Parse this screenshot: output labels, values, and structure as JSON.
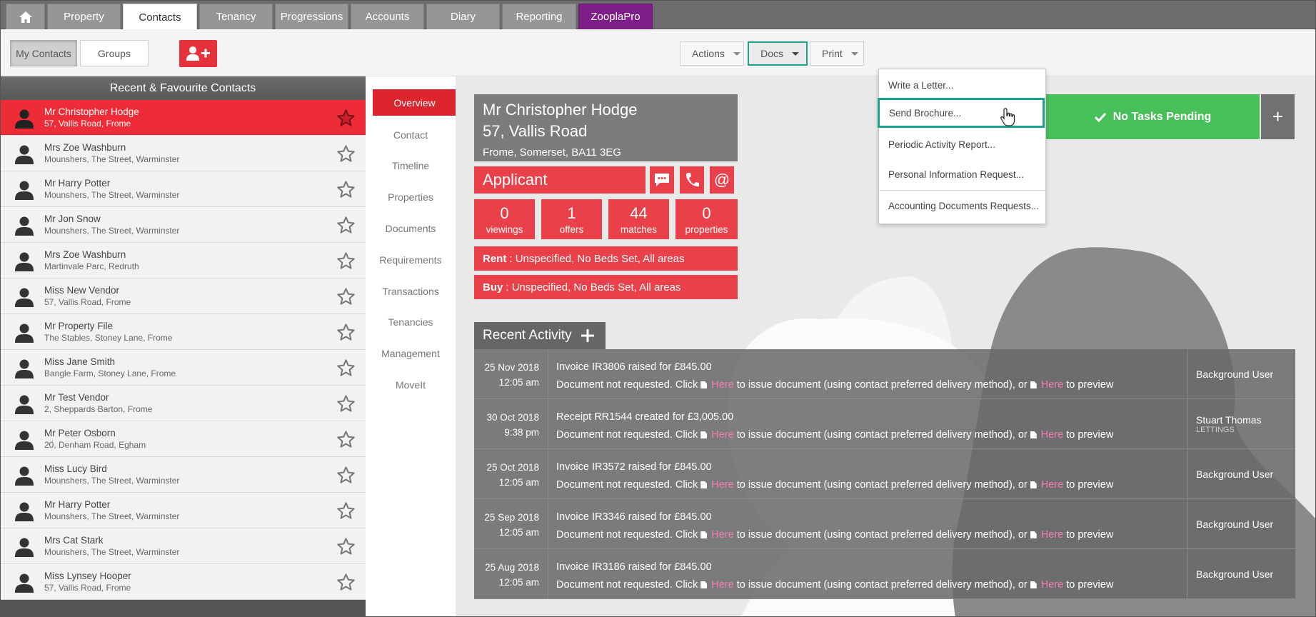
{
  "topnav": {
    "tabs": [
      {
        "label": "Property"
      },
      {
        "label": "Contacts"
      },
      {
        "label": "Tenancy"
      },
      {
        "label": "Progressions"
      },
      {
        "label": "Accounts"
      },
      {
        "label": "Diary"
      },
      {
        "label": "Reporting"
      },
      {
        "label": "ZooplaPro"
      }
    ],
    "active_tab": "Contacts",
    "zoopla_color": "#7d1f87"
  },
  "subbar": {
    "my_contacts": "My Contacts",
    "groups": "Groups",
    "actions": "Actions",
    "docs": "Docs",
    "print": "Print"
  },
  "left": {
    "header": "Recent & Favourite Contacts",
    "contacts": [
      {
        "name": "Mr Christopher Hodge",
        "address": "57, Vallis Road, Frome",
        "active": true
      },
      {
        "name": "Mrs Zoe Washburn",
        "address": "Mounshers, The Street, Warminster"
      },
      {
        "name": "Mr Harry Potter",
        "address": "Mounshers, The Street, Warminster"
      },
      {
        "name": "Mr Jon Snow",
        "address": "Mounshers, The Street, Warminster"
      },
      {
        "name": "Mrs Zoe Washburn",
        "address": "Martinvale Parc, Redruth"
      },
      {
        "name": "Miss New Vendor",
        "address": "57, Vallis Road, Frome"
      },
      {
        "name": "Mr Property File",
        "address": "The Stables, Stoney Lane, Frome"
      },
      {
        "name": "Miss Jane Smith",
        "address": "Bangle Farm, Stoney Lane, Frome"
      },
      {
        "name": "Mr Test Vendor",
        "address": "2, Sheppards Barton, Frome"
      },
      {
        "name": "Mr Peter Osborn",
        "address": "20, Denham Road, Egham"
      },
      {
        "name": "Miss Lucy Bird",
        "address": "Mounshers, The Street, Warminster"
      },
      {
        "name": "Mr Harry Potter",
        "address": "Mounshers, The Street, Warminster"
      },
      {
        "name": "Mrs Cat Stark",
        "address": "Mounshers, The Street, Warminster"
      },
      {
        "name": "Miss Lynsey Hooper",
        "address": "57, Vallis Road, Frome"
      }
    ]
  },
  "midnav": {
    "items": [
      "Overview",
      "Contact",
      "Timeline",
      "Properties",
      "Documents",
      "Requirements",
      "Transactions",
      "Tenancies",
      "Management",
      "MoveIt"
    ],
    "active": "Overview"
  },
  "contact": {
    "line1": "Mr Christopher Hodge",
    "line2": "57, Vallis Road",
    "line3": "Frome, Somerset, BA11 3EG",
    "type": "Applicant",
    "stats": [
      {
        "value": "0",
        "label": "viewings"
      },
      {
        "value": "1",
        "label": "offers"
      },
      {
        "value": "44",
        "label": "matches"
      },
      {
        "value": "0",
        "label": "properties"
      }
    ],
    "rent_label": "Rent",
    "rent_value": "Unspecified, No Beds Set, All areas",
    "buy_label": "Buy",
    "buy_value": "Unspecified, No Beds Set, All areas"
  },
  "tasks": {
    "label": "No Tasks Pending",
    "plus": "+"
  },
  "docs_menu": {
    "items": [
      "Write a Letter...",
      "Send Brochure...",
      "Periodic Activity Report...",
      "Personal Information Request...",
      "Accounting Documents Requests..."
    ],
    "highlighted": "Send Brochure..."
  },
  "recent_activity": {
    "title": "Recent Activity",
    "rows": [
      {
        "date": "25 Nov 2018",
        "time": "12:05 am",
        "title": "Invoice IR3806 raised for £845.00",
        "user": "Background User",
        "dept": ""
      },
      {
        "date": "30 Oct 2018",
        "time": "9:38 pm",
        "title": "Receipt RR1544 created for £3,005.00",
        "user": "Stuart Thomas",
        "dept": "LETTINGS"
      },
      {
        "date": "25 Oct 2018",
        "time": "12:05 am",
        "title": "Invoice IR3572 raised for £845.00",
        "user": "Background User",
        "dept": ""
      },
      {
        "date": "25 Sep 2018",
        "time": "12:05 am",
        "title": "Invoice IR3346 raised for £845.00",
        "user": "Background User",
        "dept": ""
      },
      {
        "date": "25 Aug 2018",
        "time": "12:05 am",
        "title": "Invoice IR3186 raised for £845.00",
        "user": "Background User",
        "dept": ""
      }
    ],
    "line_prefix": "Document not requested. Click",
    "link_text": "Here",
    "line_middle": "to issue document (using contact preferred delivery method), or",
    "line_suffix": "to preview"
  },
  "colors": {
    "accent_red": "#ea4049",
    "active_red": "#ee2c37",
    "tasks_green": "#48c05a",
    "highlight_teal": "#1aa38a",
    "link_pink": "#f37bb3"
  }
}
